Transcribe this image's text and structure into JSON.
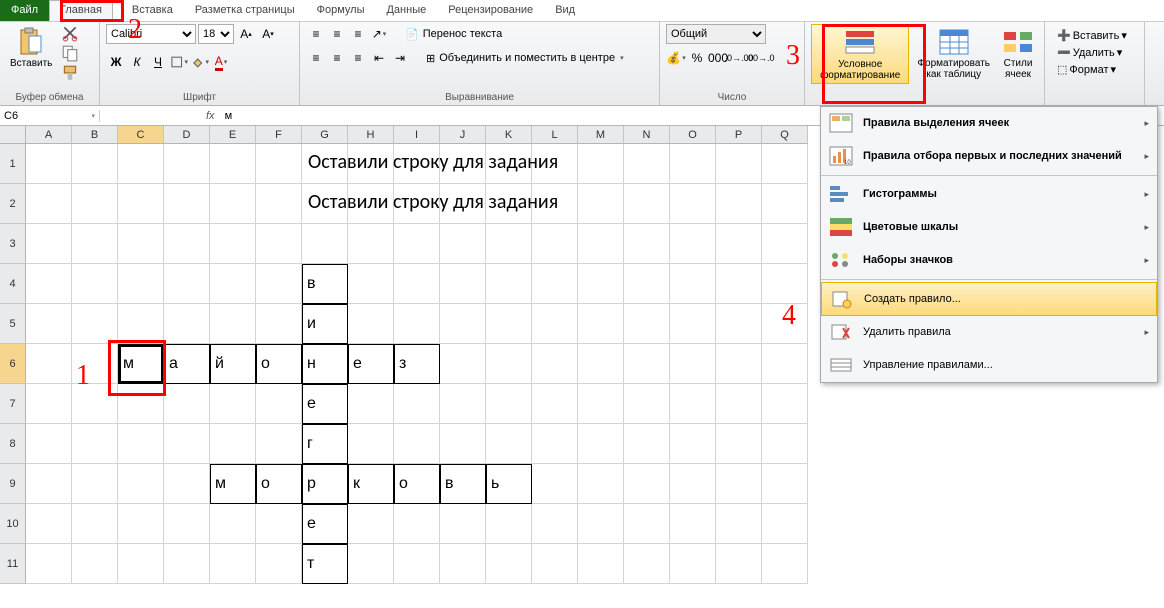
{
  "tabs": {
    "file": "Файл",
    "home": "Главная",
    "insert": "Вставка",
    "layout": "Разметка страницы",
    "formulas": "Формулы",
    "data": "Данные",
    "review": "Рецензирование",
    "view": "Вид"
  },
  "ribbon": {
    "clipboard": {
      "paste": "Вставить",
      "label": "Буфер обмена"
    },
    "font": {
      "name": "Calibri",
      "size": "18",
      "label": "Шрифт"
    },
    "alignment": {
      "wrap": "Перенос текста",
      "merge": "Объединить и поместить в центре",
      "label": "Выравнивание"
    },
    "number": {
      "format": "Общий",
      "label": "Число"
    },
    "styles": {
      "cond": "Условное\nформатирование",
      "table": "Форматировать\nкак таблицу",
      "cellstyles": "Стили\nячеек"
    },
    "cells": {
      "insert": "Вставить",
      "delete": "Удалить",
      "format": "Формат"
    }
  },
  "namebox": "C6",
  "formula": "м",
  "columns": [
    "A",
    "B",
    "C",
    "D",
    "E",
    "F",
    "G",
    "H",
    "I",
    "J",
    "K",
    "L",
    "M",
    "N",
    "O",
    "P",
    "Q"
  ],
  "rows": [
    "1",
    "2",
    "3",
    "4",
    "5",
    "6",
    "7",
    "8",
    "9",
    "10",
    "11"
  ],
  "text1": "Оставили строку для задания",
  "text2": "Оставили строку для задания",
  "crossword": {
    "row6": [
      "м",
      "а",
      "й",
      "о",
      "н",
      "е",
      "з"
    ],
    "col_g": [
      "в",
      "и",
      "н",
      "е",
      "г",
      "р",
      "е",
      "т"
    ],
    "row9": [
      "м",
      "о",
      "р",
      "к",
      "о",
      "в",
      "ь"
    ]
  },
  "dropdown": {
    "highlight_rules": "Правила выделения ячеек",
    "top_bottom": "Правила отбора первых и последних значений",
    "data_bars": "Гистограммы",
    "color_scales": "Цветовые шкалы",
    "icon_sets": "Наборы значков",
    "new_rule": "Создать правило...",
    "clear_rules": "Удалить правила",
    "manage_rules": "Управление правилами..."
  },
  "annotations": {
    "n1": "1",
    "n2": "2",
    "n3": "3",
    "n4": "4"
  }
}
